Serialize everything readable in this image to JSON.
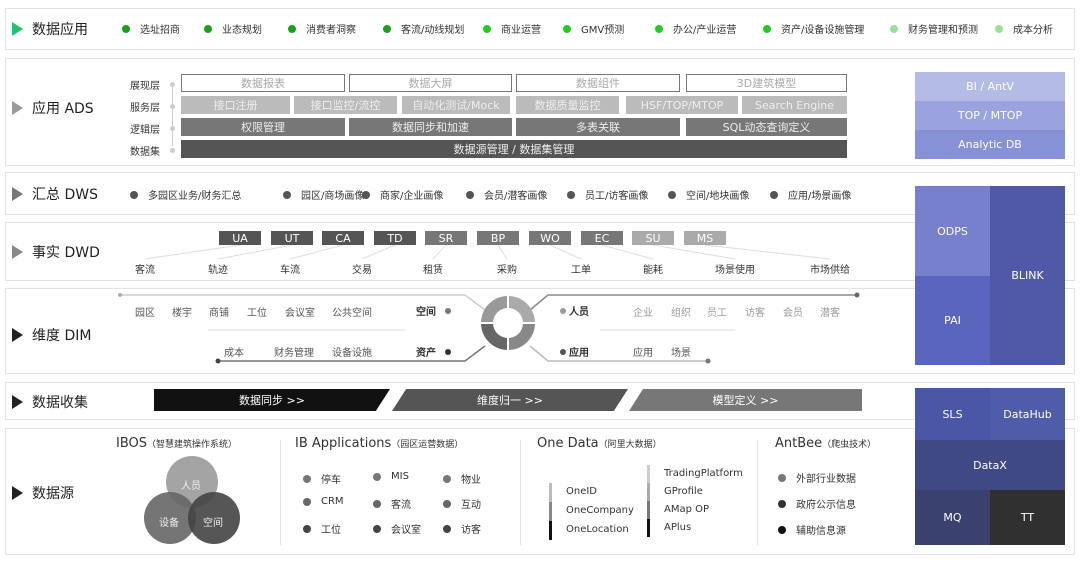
{
  "apps": {
    "title": "数据应用",
    "items": [
      {
        "label": "选址招商",
        "color": "#1aa01a"
      },
      {
        "label": "业态规划",
        "color": "#1aa01a"
      },
      {
        "label": "消费者洞察",
        "color": "#1aa01a"
      },
      {
        "label": "客流/动线规划",
        "color": "#1aa01a"
      },
      {
        "label": "商业运营",
        "color": "#22cc22"
      },
      {
        "label": "GMV预测",
        "color": "#22cc22"
      },
      {
        "label": "办公/产业运营",
        "color": "#22cc22"
      },
      {
        "label": "资产/设备设施管理",
        "color": "#22cc22"
      },
      {
        "label": "财务管理和预测",
        "color": "#99e099"
      },
      {
        "label": "成本分析",
        "color": "#99e099"
      }
    ]
  },
  "ads": {
    "title": "应用 ADS",
    "layers": [
      "展现层",
      "服务层",
      "逻辑层",
      "数据集"
    ],
    "presentation": [
      "数据报表",
      "数据大屏",
      "数据组件",
      "3D建筑模型"
    ],
    "service": [
      "接口注册",
      "接口监控/流控",
      "自动化测试/Mock",
      "数据质量监控",
      "HSF/TOP/MTOP",
      "Search Engine"
    ],
    "logic": [
      "权限管理",
      "数据同步和加速",
      "多表关联",
      "SQL动态查询定义"
    ],
    "dataset": "数据源管理 / 数据集管理",
    "stack": [
      "BI / AntV",
      "TOP / MTOP",
      "Analytic DB"
    ]
  },
  "dws": {
    "title": "汇总 DWS",
    "items": [
      "多园区业务/财务汇总",
      "园区/商场画像",
      "商家/企业画像",
      "会员/潜客画像",
      "员工/访客画像",
      "空间/地块画像",
      "应用/场景画像"
    ]
  },
  "dwd": {
    "title": "事实 DWD",
    "codes": [
      "UA",
      "UT",
      "CA",
      "TD",
      "SR",
      "BP",
      "WO",
      "EC",
      "SU",
      "MS"
    ],
    "facts": [
      "客流",
      "轨迹",
      "车流",
      "交易",
      "租赁",
      "采购",
      "工单",
      "能耗",
      "场景使用",
      "市场供给"
    ]
  },
  "dim": {
    "title": "维度 DIM",
    "space": {
      "label": "空间",
      "items": [
        "园区",
        "楼宇",
        "商铺",
        "工位",
        "会议室",
        "公共空间"
      ]
    },
    "asset": {
      "label": "资产",
      "items": [
        "成本",
        "财务管理",
        "设备设施"
      ]
    },
    "people": {
      "label": "人员",
      "items": [
        "企业",
        "组织",
        "员工",
        "访客",
        "会员",
        "潜客"
      ]
    },
    "application": {
      "label": "应用",
      "items": [
        "应用",
        "场景"
      ]
    }
  },
  "compute": [
    "ODPS",
    "PAI",
    "BLINK"
  ],
  "collect": {
    "title": "数据收集",
    "steps": [
      "数据同步  >>",
      "维度归一  >>",
      "模型定义  >>"
    ]
  },
  "source": {
    "title": "数据源",
    "ibos": {
      "name": "IBOS",
      "note": "（智慧建筑操作系统）",
      "circles": [
        "人员",
        "设备",
        "空间"
      ]
    },
    "ib": {
      "name": "IB Applications",
      "note": "（园区运营数据）",
      "items": [
        "停车",
        "MIS",
        "物业",
        "CRM",
        "客流",
        "互动",
        "工位",
        "会议室",
        "访客"
      ]
    },
    "onedata": {
      "name": "One Data",
      "note": "（阿里大数据）",
      "left": [
        "OneID",
        "OneCompany",
        "OneLocation"
      ],
      "right": [
        "TradingPlatform",
        "GProfile",
        "AMap OP",
        "APlus"
      ]
    },
    "antbee": {
      "name": "AntBee",
      "note": "（爬虫技术）",
      "items": [
        "外部行业数据",
        "政府公示信息",
        "辅助信息源"
      ]
    }
  },
  "ingest": [
    "SLS",
    "DataHub",
    "DataX",
    "MQ",
    "TT"
  ]
}
